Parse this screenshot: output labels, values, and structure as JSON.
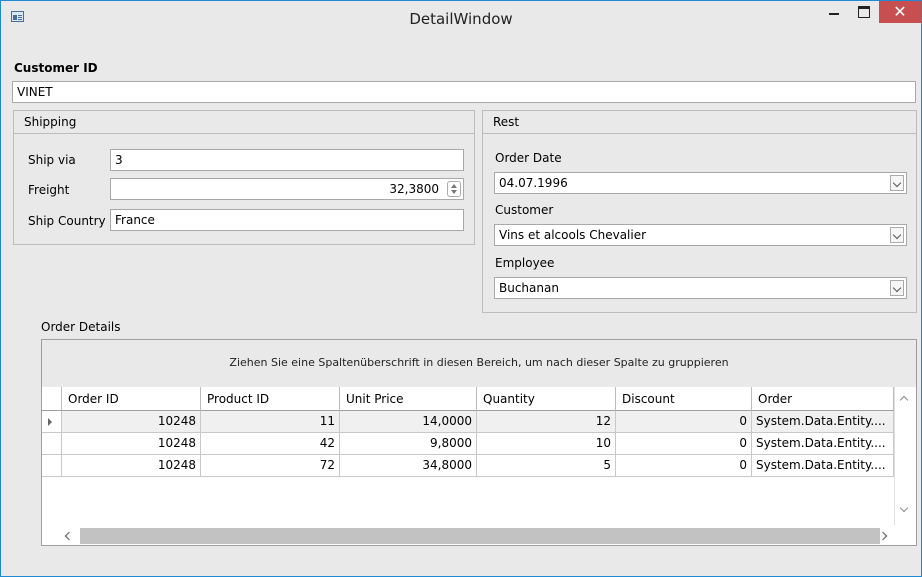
{
  "window": {
    "title": "DetailWindow",
    "close_glyph": "✕"
  },
  "customer": {
    "label": "Customer ID",
    "value": "VINET"
  },
  "shipping": {
    "header": "Shipping",
    "ship_via_label": "Ship via",
    "ship_via_value": "3",
    "freight_label": "Freight",
    "freight_value": "32,3800",
    "country_label": "Ship Country",
    "country_value": "France"
  },
  "rest": {
    "header": "Rest",
    "order_date_label": "Order Date",
    "order_date_value": "04.07.1996",
    "customer_label": "Customer",
    "customer_value": "Vins et alcools Chevalier",
    "employee_label": "Employee",
    "employee_value": "Buchanan"
  },
  "details": {
    "label": "Order Details",
    "group_hint": "Ziehen Sie eine Spaltenüberschrift in diesen Bereich, um nach dieser Spalte zu gruppieren",
    "columns": [
      "Order ID",
      "Product ID",
      "Unit Price",
      "Quantity",
      "Discount",
      "Order"
    ],
    "rows": [
      [
        "10248",
        "11",
        "14,0000",
        "12",
        "0",
        "System.Data.Entity...."
      ],
      [
        "10248",
        "42",
        "9,8000",
        "10",
        "0",
        "System.Data.Entity...."
      ],
      [
        "10248",
        "72",
        "34,8000",
        "5",
        "0",
        "System.Data.Entity...."
      ]
    ]
  }
}
